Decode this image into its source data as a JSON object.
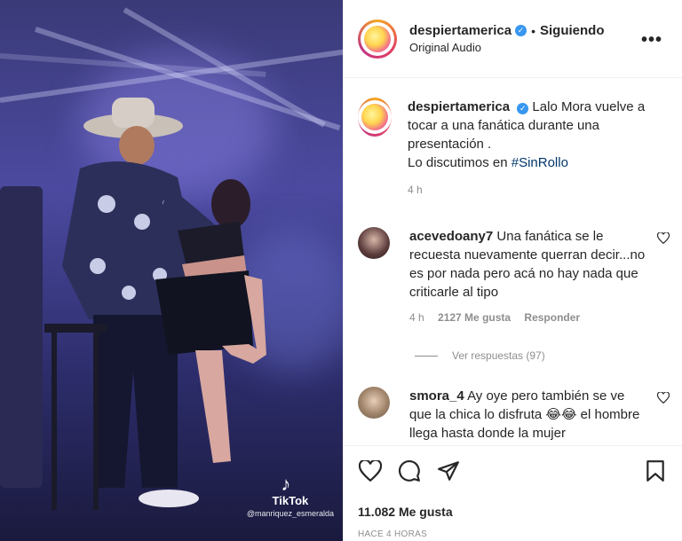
{
  "media": {
    "watermark_brand": "TikTok",
    "watermark_user": "@manriquez_esmeralda"
  },
  "header": {
    "username": "despiertamerica",
    "separator": "•",
    "follow_status": "Siguiendo",
    "audio": "Original Audio",
    "more": "•••"
  },
  "caption": {
    "username": "despiertamerica",
    "text_part1": "Lalo Mora vuelve a tocar a una fanática durante una presentación .",
    "text_part2": "Lo discutimos en ",
    "hashtag": "#SinRollo",
    "time": "4 h"
  },
  "comments": [
    {
      "username": "acevedoany7",
      "text": "Una fanática se le recuesta nuevamente querran decir...no es por nada pero acá no hay nada que criticarle al tipo",
      "time": "4 h",
      "likes": "2127 Me gusta",
      "reply": "Responder"
    },
    {
      "username": "smora_4",
      "text": "Ay oye pero también se ve que la chica lo disfruta 😂😂 el hombre llega hasta donde la mujer"
    }
  ],
  "view_replies": "Ver respuestas (97)",
  "footer": {
    "likes": "11.082 Me gusta",
    "posted": "HACE 4 HORAS"
  },
  "colors": {
    "link": "#00376b",
    "verified": "#3897f0",
    "muted": "#8e8e8e"
  }
}
